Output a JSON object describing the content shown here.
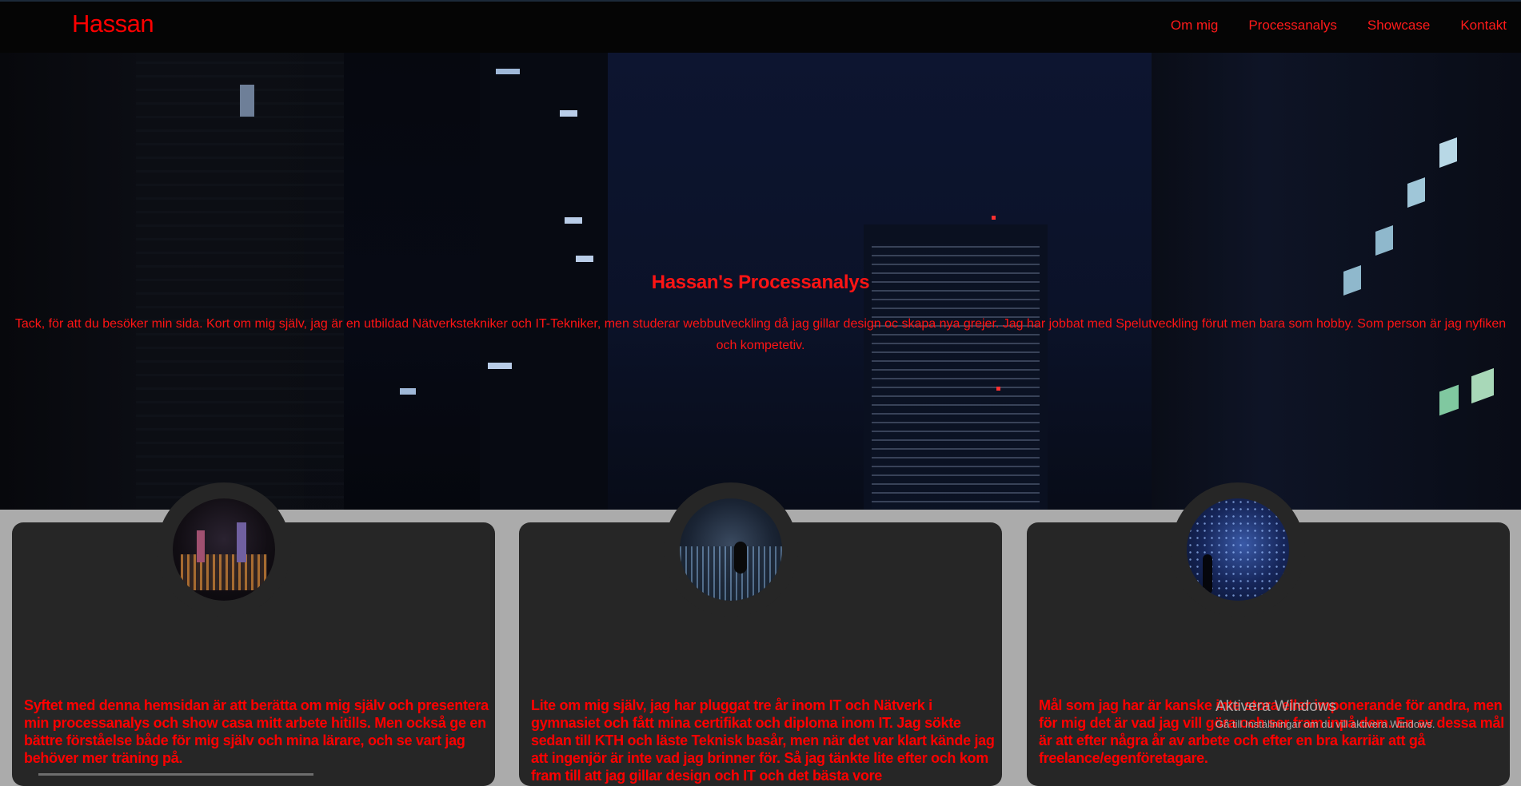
{
  "header": {
    "brand": "Hassan",
    "nav": [
      "Om mig",
      "Processanalys",
      "Showcase",
      "Kontakt"
    ]
  },
  "hero": {
    "title": "Hassan's Processanalys",
    "text": "Tack, för att du besöker min sida. Kort om mig själv, jag är en utbildad Nätverkstekniker och IT-Tekniker, men studerar webbutveckling då jag gillar design oc skapa nya grejer. Jag har jobbat med Spelutveckling förut men bara som hobby. Som person är jag nyfiken och kompetetiv."
  },
  "cards": [
    {
      "text": "Syftet med denna hemsidan är att berätta om mig själv och presentera min processanalys och show casa mitt arbete hitills. Men också ge en bättre förståelse både för mig själv och mina lärare, och se vart jag behöver mer träning på."
    },
    {
      "text": "Lite om mig själv, jag har pluggat tre år inom IT och Nätverk i gymnasiet och fått mina certifikat och diploma inom IT. Jag sökte sedan till KTH och läste Teknisk basår, men när det var klart kände jag att ingenjör är inte vad jag brinner för. Så jag tänkte lite efter och kom fram till att jag gillar design och IT och det bästa vore"
    },
    {
      "text": "Mål som jag har är kanske inte stora eller imponerande för andra, men för mig det är vad jag vill göra och ser fram inpå dem. En av dessa mål är att efter några år av arbete och efter en bra karriär att gå freelance/egenföretagare."
    }
  ],
  "watermark": {
    "title": "Aktivera Windows",
    "subtitle": "Gå till Inställningar om du vill aktivera Windows."
  },
  "colors": {
    "accent": "#ff0000",
    "topbar": "#050505",
    "card": "#262626",
    "page_bg": "#ababab"
  }
}
